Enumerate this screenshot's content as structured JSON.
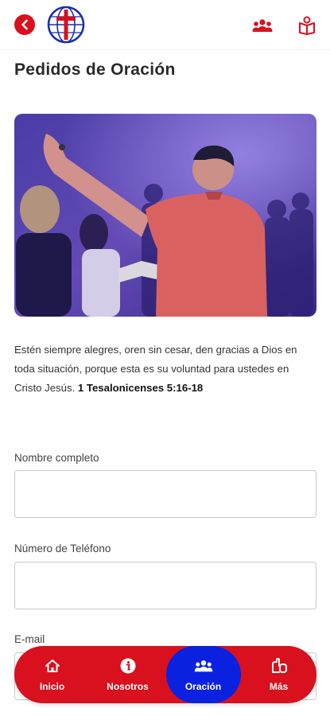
{
  "colors": {
    "brand_red": "#d9101e",
    "active_blue": "#0a22e0"
  },
  "header": {
    "back_icon": "chevron-left-icon",
    "logo_icon": "church-globe-cross-logo",
    "right_icons": [
      "group-icon",
      "bible-book-icon"
    ]
  },
  "page": {
    "title": "Pedidos de Oración"
  },
  "hero_image": {
    "subject": "worshipper-raising-hand-photo"
  },
  "verse": {
    "text": "Estén siempre alegres, oren sin cesar, den gracias a Dios en toda situación, porque esta es su voluntad para ustedes en Cristo Jesús.",
    "reference": "1 Tesalonicenses 5:16-18"
  },
  "form": {
    "name_label": "Nombre completo",
    "name_value": "",
    "phone_label": "Número de Teléfono",
    "phone_value": "",
    "email_label": "E-mail",
    "email_value": ""
  },
  "nav": {
    "items": [
      {
        "label": "Inicio",
        "icon": "home-icon",
        "active": false
      },
      {
        "label": "Nosotros",
        "icon": "info-icon",
        "active": false
      },
      {
        "label": "Oración",
        "icon": "group-icon",
        "active": true
      },
      {
        "label": "Más",
        "icon": "more-hands-icon",
        "active": false
      }
    ]
  }
}
